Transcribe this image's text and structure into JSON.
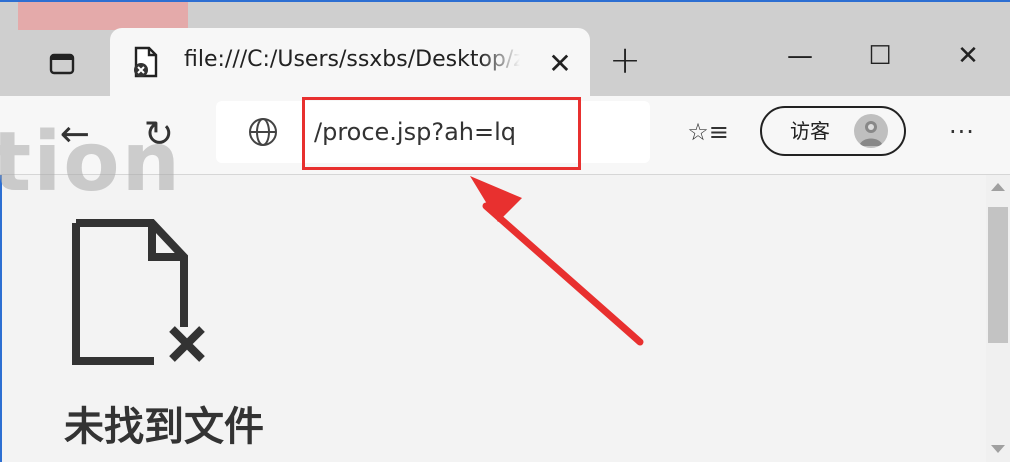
{
  "browser": {
    "tab": {
      "title": "file:///C:/Users/ssxbs/Desktop/zh",
      "close_symbol": "✕",
      "favicon": "file-error-icon"
    },
    "new_tab_symbol": "+",
    "window_controls": {
      "minimize": "—",
      "maximize": "☐",
      "close": "✕"
    },
    "toolbar": {
      "back_symbol": "←",
      "refresh_symbol": "↻",
      "address_url": "/proce.jsp?ah=lq",
      "favorites_symbol": "☆≡",
      "profile_label": "访客",
      "more_symbol": "···"
    }
  },
  "page": {
    "error_heading": "未找到文件",
    "error_icon": "file-missing-icon"
  },
  "annotation": {
    "highlight_color": "#e8302f",
    "arrow_color": "#e8302f"
  },
  "watermark": {
    "text": "tion"
  },
  "colors": {
    "accent": "#2d6fd2",
    "tab_strip": "#cfcfcf",
    "toolbar": "#f7f7f7",
    "content": "#f3f3f3"
  }
}
